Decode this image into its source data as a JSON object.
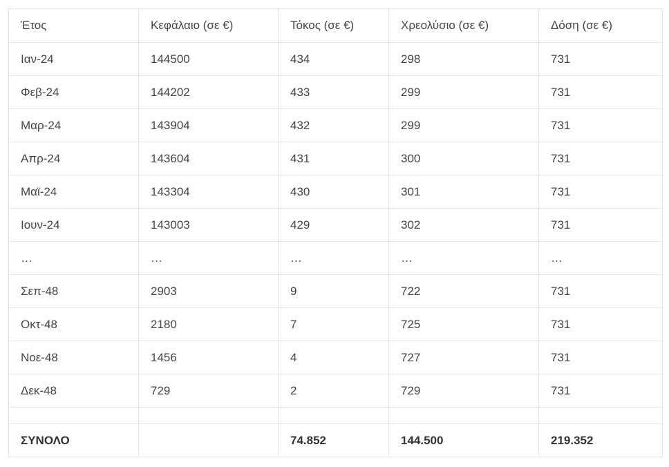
{
  "table": {
    "headers": [
      "Έτος",
      "Κεφάλαιο (σε €)",
      "Τόκος (σε €)",
      "Χρεολύσιο (σε €)",
      "Δόση (σε €)"
    ],
    "rows": [
      [
        "Ιαν-24",
        "144500",
        "434",
        "298",
        "731"
      ],
      [
        "Φεβ-24",
        "144202",
        "433",
        "299",
        "731"
      ],
      [
        "Μαρ-24",
        "143904",
        "432",
        "299",
        "731"
      ],
      [
        "Απρ-24",
        "143604",
        "431",
        "300",
        "731"
      ],
      [
        "Μαϊ-24",
        "143304",
        "430",
        "301",
        "731"
      ],
      [
        "Ιουν-24",
        "143003",
        "429",
        "302",
        "731"
      ],
      [
        "…",
        "…",
        "…",
        "…",
        "…"
      ],
      [
        "Σεπ-48",
        "2903",
        "9",
        "722",
        "731"
      ],
      [
        "Οκτ-48",
        "2180",
        "7",
        "725",
        "731"
      ],
      [
        "Νοε-48",
        "1456",
        "4",
        "727",
        "731"
      ],
      [
        "Δεκ-48",
        "729",
        "2",
        "729",
        "731"
      ]
    ],
    "total": [
      "ΣΥΝΟΛΟ",
      "",
      "74.852",
      "144.500",
      "219.352"
    ]
  }
}
